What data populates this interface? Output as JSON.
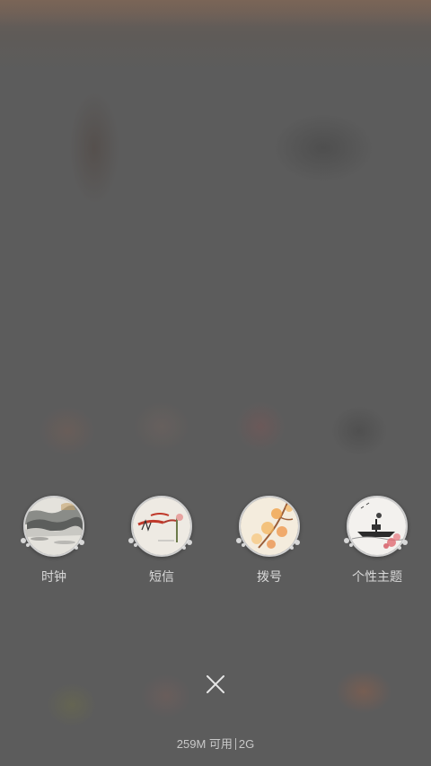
{
  "dock": {
    "apps": [
      {
        "label": "时钟",
        "icon": "clock-app-icon"
      },
      {
        "label": "短信",
        "icon": "messages-app-icon"
      },
      {
        "label": "拨号",
        "icon": "phone-app-icon"
      },
      {
        "label": "个性主题",
        "icon": "themes-app-icon"
      }
    ]
  },
  "close": {
    "icon": "close-icon"
  },
  "footer": {
    "memory": "259M 可用",
    "network": "2G"
  },
  "colors": {
    "overlay": "#5c5c5c",
    "label_text": "#d8d8d8",
    "bubble_border": "#dcdcdc"
  }
}
